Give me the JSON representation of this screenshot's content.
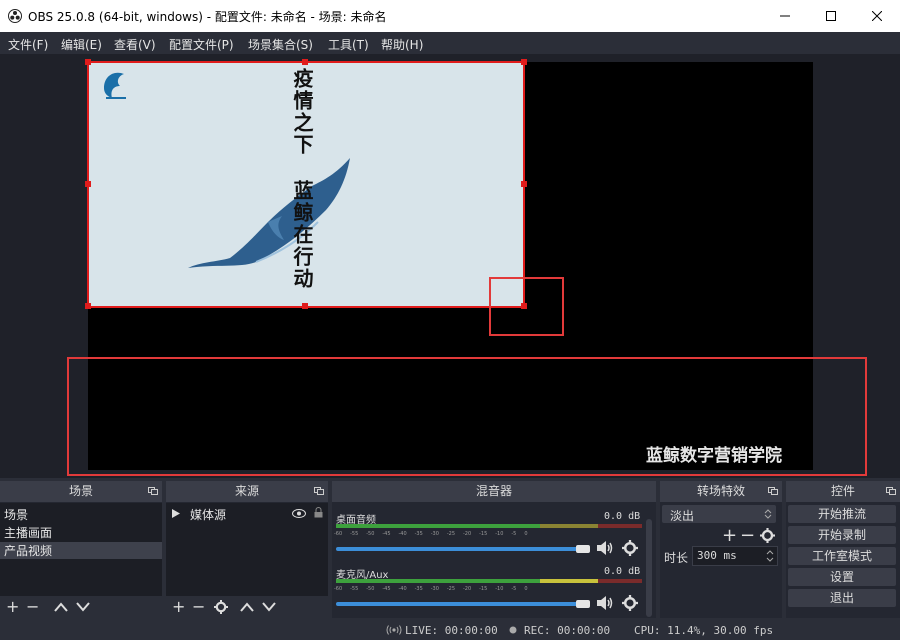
{
  "window": {
    "title": "OBS 25.0.8 (64-bit, windows) - 配置文件: 未命名 - 场景: 未命名"
  },
  "menu": [
    {
      "label": "文件(F)"
    },
    {
      "label": "编辑(E)"
    },
    {
      "label": "查看(V)"
    },
    {
      "label": "配置文件(P)"
    },
    {
      "label": "场景集合(S)"
    },
    {
      "label": "工具(T)"
    },
    {
      "label": "帮助(H)"
    }
  ],
  "preview": {
    "source_text_line1": "疫情之下",
    "source_text_line2": "蓝鲸在行动",
    "watermark": "蓝鲸数字营销学院"
  },
  "scenes": {
    "title": "场景",
    "items": [
      "场景",
      "主播画面",
      "产品视频"
    ],
    "selected": "产品视频"
  },
  "sources": {
    "title": "来源",
    "items": [
      {
        "label": "媒体源"
      }
    ]
  },
  "mixer": {
    "title": "混音器",
    "channels": [
      {
        "name": "桌面音频",
        "db": "0.0 dB"
      },
      {
        "name": "麦克风/Aux",
        "db": "0.0 dB"
      }
    ],
    "ticks": [
      "-60",
      "-55",
      "-50",
      "-45",
      "-40",
      "-35",
      "-30",
      "-25",
      "-20",
      "-15",
      "-10",
      "-5",
      "0"
    ]
  },
  "transitions": {
    "title": "转场特效",
    "selected": "淡出",
    "duration_label": "时长",
    "duration_value": "300 ms"
  },
  "controls": {
    "title": "控件",
    "buttons": [
      "开始推流",
      "开始录制",
      "工作室模式",
      "设置",
      "退出"
    ]
  },
  "status": {
    "live": "LIVE: 00:00:00",
    "rec": "REC: 00:00:00",
    "cpu": "CPU: 11.4%, 30.00 fps"
  },
  "colors": {
    "selection_red": "#e01c1c",
    "accent_blue": "#3c8ed9",
    "meter_green": "#3da13d",
    "meter_yellow": "#c8c23c",
    "meter_red": "#b83a3a"
  }
}
